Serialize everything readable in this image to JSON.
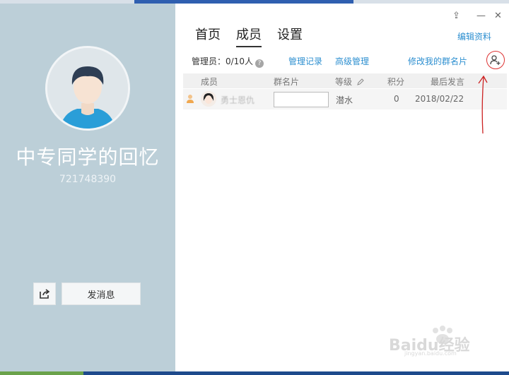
{
  "group": {
    "name": "中专同学的回忆",
    "id": "721748390"
  },
  "left_panel": {
    "send_message_label": "发消息"
  },
  "window_controls": {
    "pin": "⇪",
    "minimize": "—",
    "close": "✕"
  },
  "tabs": [
    {
      "label": "首页"
    },
    {
      "label": "成员",
      "active": true
    },
    {
      "label": "设置"
    }
  ],
  "header": {
    "edit_profile": "编辑资料"
  },
  "toolbar": {
    "admin_count": "管理员：0/10人",
    "help_glyph": "?",
    "manage_log": "管理记录",
    "advanced_manage": "高级管理",
    "edit_my_card": "修改我的群名片"
  },
  "columns": {
    "member": "成员",
    "group_card": "群名片",
    "level": "等级",
    "points": "积分",
    "last_speak": "最后发言"
  },
  "members": [
    {
      "name": "勇士恩仇",
      "group_card": "",
      "level": "潜水",
      "points": "0",
      "last_speak": "2018/02/22"
    }
  ],
  "watermark": {
    "text": "Baidu经验",
    "sub": "jingyan.baidu.com"
  },
  "colors": {
    "left_panel": "#bccfd8",
    "link": "#2d8fd0",
    "annotation": "#cc2222"
  }
}
